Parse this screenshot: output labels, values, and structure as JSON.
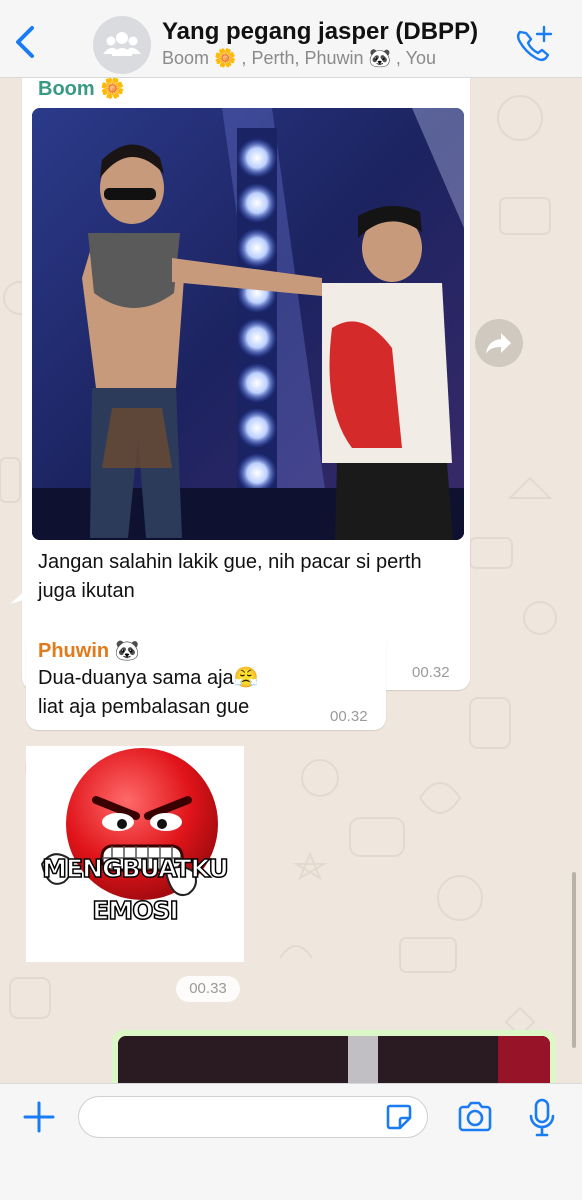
{
  "header": {
    "back_icon": "chevron-left-icon",
    "group_avatar_icon": "group-avatar-icon",
    "title": "Yang pegang jasper (DBPP)",
    "subtitle": "Boom 🌼 , Perth, Phuwin 🐼 , You",
    "call_icon": "add-call-icon",
    "accent_color": "#1a7cf5"
  },
  "messages": [
    {
      "sender": "Boom 🌼",
      "sender_color": "#3a9a86",
      "type": "image-with-caption",
      "text": "Jangan salahin lakik gue, nih pacar si perth juga ikutan",
      "time": "00.32"
    },
    {
      "sender": "Phuwin 🐼",
      "sender_color": "#e07a1a",
      "type": "text",
      "line1": "Dua-duanya sama aja😤",
      "line2": "liat aja pembalasan gue",
      "time": "00.32"
    },
    {
      "type": "sticker",
      "caption1": "MENGBUATKU",
      "caption2": "EMOSI",
      "time": "00.33"
    },
    {
      "type": "image",
      "bubble_color": "#dcf8c6"
    }
  ],
  "forward_icon": "forward-icon",
  "input_bar": {
    "plus_icon": "plus-icon",
    "sticker_icon": "sticker-icon",
    "camera_icon": "camera-icon",
    "mic_icon": "microphone-icon"
  }
}
